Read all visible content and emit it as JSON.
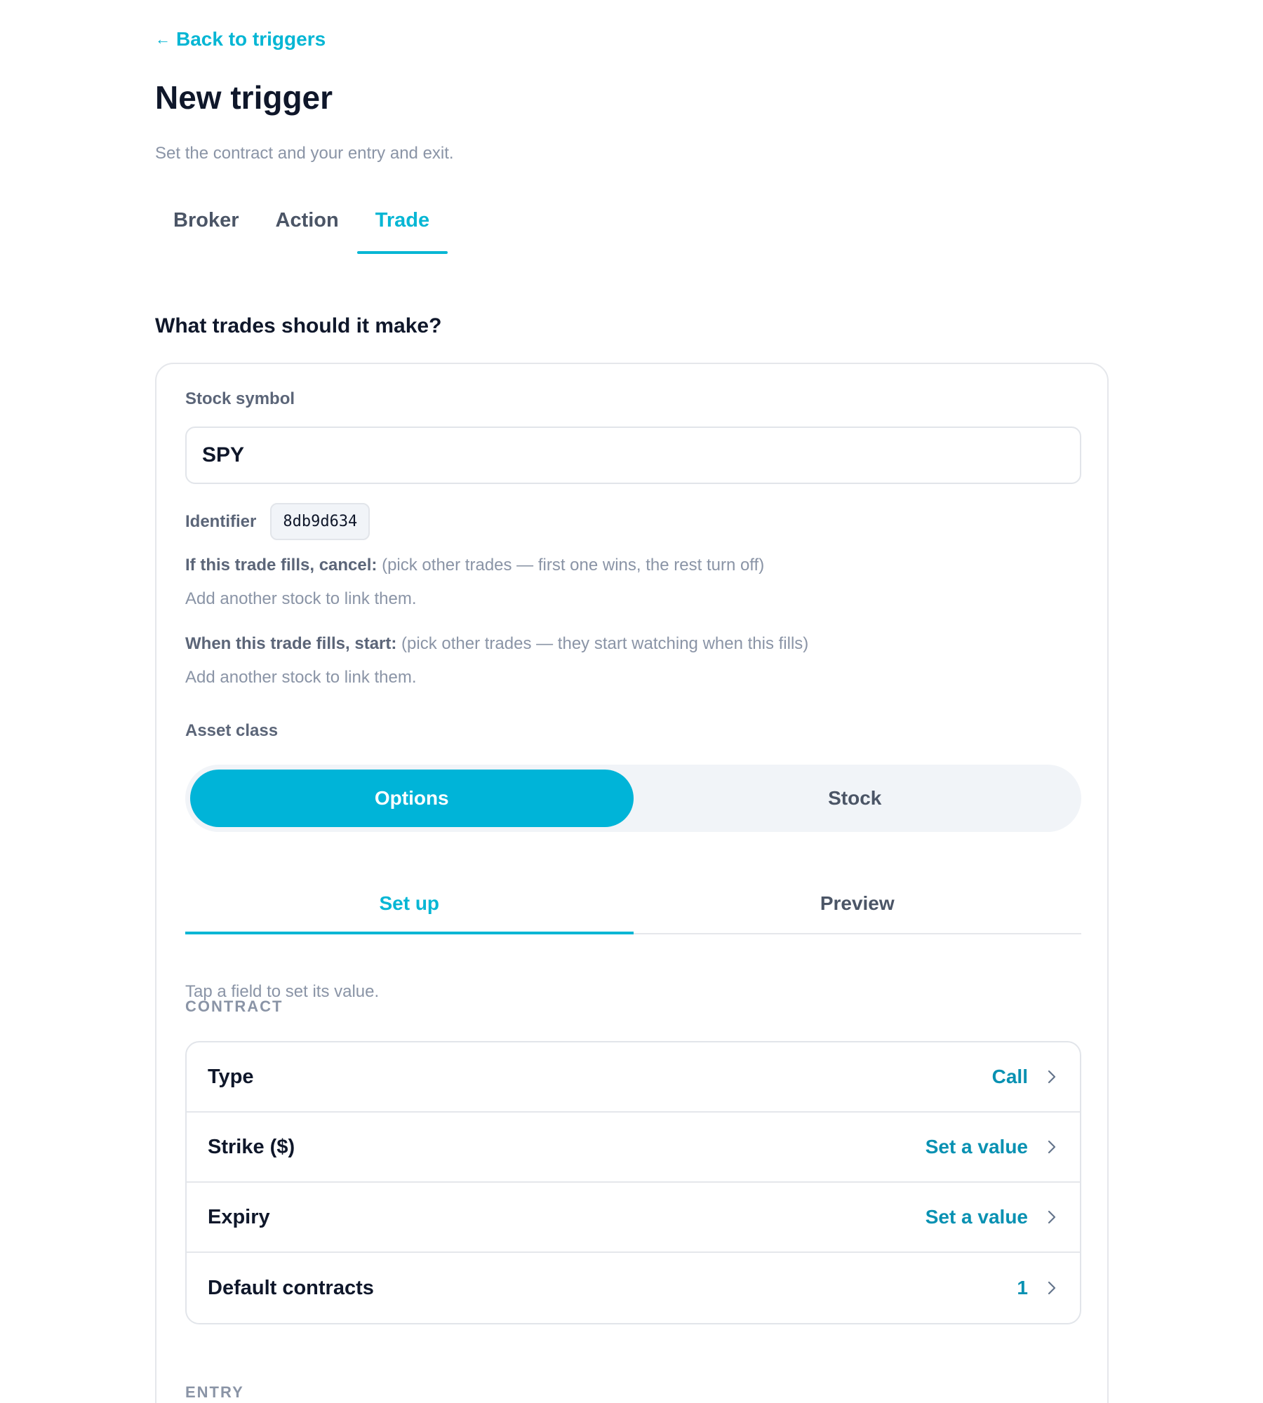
{
  "back_link": {
    "arrow": "←",
    "label": "Back to triggers"
  },
  "page": {
    "title": "New trigger",
    "subtitle": "Set the contract and your entry and exit."
  },
  "steps": [
    {
      "label": "Broker",
      "active": false
    },
    {
      "label": "Action",
      "active": false
    },
    {
      "label": "Trade",
      "active": true
    }
  ],
  "section_title": "What trades should it make?",
  "form": {
    "symbol_label": "Stock symbol",
    "symbol_value": "SPY",
    "identifier_label": "Identifier",
    "identifier_value": "8db9d634",
    "cancel_rule": {
      "bold": "If this trade fills, cancel:",
      "hint": "(pick other trades — first one wins, the rest turn off)",
      "add_link": "Add another stock to link them."
    },
    "start_rule": {
      "bold": "When this trade fills, start:",
      "hint": "(pick other trades — they start watching when this fills)",
      "add_link": "Add another stock to link them."
    },
    "asset_class_label": "Asset class",
    "asset_class_options": [
      {
        "label": "Options",
        "active": true
      },
      {
        "label": "Stock",
        "active": false
      }
    ],
    "subtabs": [
      {
        "label": "Set up",
        "active": true
      },
      {
        "label": "Preview",
        "active": false
      }
    ],
    "tap_hint": "Tap a field to set its value.",
    "contract_group_label": "CONTRACT",
    "contract_rows": [
      {
        "label": "Type",
        "value": "Call"
      },
      {
        "label": "Strike ($)",
        "value": "Set a value"
      },
      {
        "label": "Expiry",
        "value": "Set a value"
      },
      {
        "label": "Default contracts",
        "value": "1"
      }
    ],
    "entry_group_label": "ENTRY"
  },
  "colors": {
    "accent": "#06b6d4",
    "accent_fill": "#00b4d8",
    "value_text": "#0891b2",
    "heading": "#0f172a",
    "muted": "#8a94a6"
  }
}
